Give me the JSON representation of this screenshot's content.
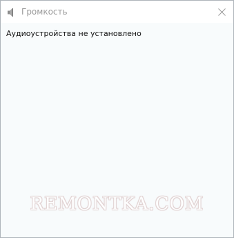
{
  "window": {
    "title": "Громкость",
    "title_icon": "speaker-icon",
    "close_icon": "close-icon"
  },
  "main": {
    "message": "Аудиоустройства не установлено"
  },
  "watermark": {
    "text": "REMONTKA.COM"
  },
  "colors": {
    "title_text": "#9a9a9a",
    "content_bg": "#f8fbfc",
    "border": "#aeb4ba"
  }
}
